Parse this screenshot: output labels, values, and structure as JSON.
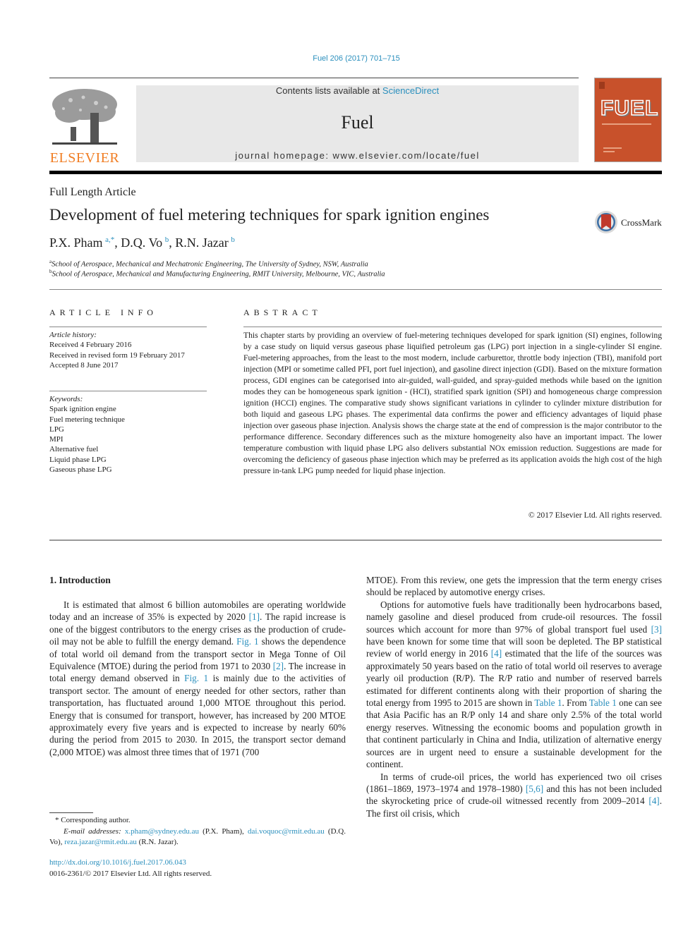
{
  "masthead": {
    "citation": "Fuel 206 (2017) 701–715",
    "contents_prefix": "Contents lists available at ",
    "contents_link": "ScienceDirect",
    "journal_name": "Fuel",
    "homepage": "journal homepage: www.elsevier.com/locate/fuel",
    "publisher_logo_text": "ELSEVIER",
    "cover_title": "FUEL"
  },
  "article": {
    "type": "Full Length Article",
    "title": "Development of fuel metering techniques for spark ignition engines",
    "crossmark_label": "CrossMark",
    "authors": [
      {
        "name": "P.X. Pham",
        "sup": "a,*"
      },
      {
        "name": "D.Q. Vo",
        "sup": "b"
      },
      {
        "name": "R.N. Jazar",
        "sup": "b"
      }
    ],
    "affiliations": [
      {
        "mark": "a",
        "text": "School of Aerospace, Mechanical and Mechatronic Engineering, The University of Sydney, NSW, Australia"
      },
      {
        "mark": "b",
        "text": "School of Aerospace, Mechanical and Manufacturing Engineering, RMIT University, Melbourne, VIC, Australia"
      }
    ]
  },
  "article_info": {
    "heading": "ARTICLE INFO",
    "history_label": "Article history:",
    "history": [
      "Received 4 February 2016",
      "Received in revised form 19 February 2017",
      "Accepted 8 June 2017"
    ],
    "keywords_label": "Keywords:",
    "keywords": [
      "Spark ignition engine",
      "Fuel metering technique",
      "LPG",
      "MPI",
      "Alternative fuel",
      "Liquid phase LPG",
      "Gaseous phase LPG"
    ]
  },
  "abstract": {
    "heading": "ABSTRACT",
    "text": "This chapter starts by providing an overview of fuel-metering techniques developed for spark ignition (SI) engines, following by a case study on liquid versus gaseous phase liquified petroleum gas (LPG) port injection in a single-cylinder SI engine. Fuel-metering approaches, from the least to the most modern, include carburettor, throttle body injection (TBI), manifold port injection (MPI or sometime called PFI, port fuel injection), and gasoline direct injection (GDI). Based on the mixture formation process, GDI engines can be categorised into air-guided, wall-guided, and spray-guided methods while based on the ignition modes they can be homogeneous spark ignition - (HCI), stratified spark ignition (SPI) and homogeneous charge compression ignition (HCCI) engines. The comparative study shows significant variations in cylinder to cylinder mixture distribution for both liquid and gaseous LPG phases. The experimental data confirms the power and efficiency advantages of liquid phase injection over gaseous phase injection. Analysis shows the charge state at the end of compression is the major contributor to the performance difference. Secondary differences such as the mixture homogeneity also have an important impact. The lower temperature combustion with liquid phase LPG also delivers substantial NOx emission reduction. Suggestions are made for overcoming the deficiency of gaseous phase injection which may be preferred as its application avoids the high cost of the high pressure in-tank LPG pump needed for liquid phase injection.",
    "copyright": "© 2017 Elsevier Ltd. All rights reserved."
  },
  "body": {
    "section_heading": "1. Introduction",
    "left": {
      "p1": [
        {
          "t": "It is estimated that almost 6 billion automobiles are operating worldwide today and an increase of 35% is expected by 2020 "
        },
        {
          "link": "[1]"
        },
        {
          "t": ". The rapid increase is one of the biggest contributors to the energy crises as the production of crude-oil may not be able to fulfill the energy demand. "
        },
        {
          "link": "Fig. 1"
        },
        {
          "t": " shows the dependence of total world oil demand from the transport sector in Mega Tonne of Oil Equivalence (MTOE) during the period from 1971 to 2030 "
        },
        {
          "link": "[2]"
        },
        {
          "t": ". The increase in total energy demand observed in "
        },
        {
          "link": "Fig. 1"
        },
        {
          "t": " is mainly due to the activities of transport sector. The amount of energy needed for other sectors, rather than transportation, has fluctuated around 1,000 MTOE throughout this period. Energy that is consumed for transport, however, has increased by 200 MTOE approximately every five years and is expected to increase by nearly 60% during the period from 2015 to 2030. In 2015, the transport sector demand (2,000 MTOE) was almost three times that of 1971 (700"
        }
      ]
    },
    "right": {
      "p0": "MTOE). From this review, one gets the impression that the term energy crises should be replaced by automotive energy crises.",
      "p1": [
        {
          "t": "Options for automotive fuels have traditionally been hydrocarbons based, namely gasoline and diesel produced from crude-oil resources. The fossil sources which account for more than 97% of global transport fuel used "
        },
        {
          "link": "[3]"
        },
        {
          "t": " have been known for some time that will soon be depleted. The BP statistical review of world energy in 2016 "
        },
        {
          "link": "[4]"
        },
        {
          "t": " estimated that the life of the sources was approximately 50 years based on the ratio of total world oil reserves to average yearly oil production (R/P). The R/P ratio and number of reserved barrels estimated for different continents along with their proportion of sharing the total energy from 1995 to 2015 are shown in "
        },
        {
          "link": "Table 1"
        },
        {
          "t": ". From "
        },
        {
          "link": "Table 1"
        },
        {
          "t": " one can see that Asia Pacific has an R/P only 14 and share only 2.5% of the total world energy reserves. Witnessing the economic booms and population growth in that continent particularly in China and India, utilization of alternative energy sources are in urgent need to ensure a sustainable development for the continent."
        }
      ],
      "p2": [
        {
          "t": "In terms of crude-oil prices, the world has experienced two oil crises (1861–1869, 1973–1974 and 1978–1980) "
        },
        {
          "link": "[5,6]"
        },
        {
          "t": " and this has not been included the skyrocketing price of crude-oil witnessed recently from 2009–2014 "
        },
        {
          "link": "[4]"
        },
        {
          "t": ". The first oil crisis, which"
        }
      ]
    }
  },
  "footnotes": {
    "corresponding": "* Corresponding author.",
    "email_label": "E-mail addresses: ",
    "emails": [
      {
        "addr": "x.pham@sydney.edu.au",
        "who": " (P.X. Pham), "
      },
      {
        "addr": "dai.voquoc@rmit.edu.au",
        "who": " (D.Q. Vo), "
      },
      {
        "addr": "reza.jazar@rmit.edu.au",
        "who": " (R.N. Jazar)."
      }
    ],
    "doi": "http://dx.doi.org/10.1016/j.fuel.2017.06.043",
    "issn_line": "0016-2361/© 2017 Elsevier Ltd. All rights reserved."
  },
  "colors": {
    "link": "#2a8fbd",
    "elsevier_orange": "#f07d23",
    "cover_orange": "#c8512b",
    "journal_box": "#e8e8e8"
  }
}
